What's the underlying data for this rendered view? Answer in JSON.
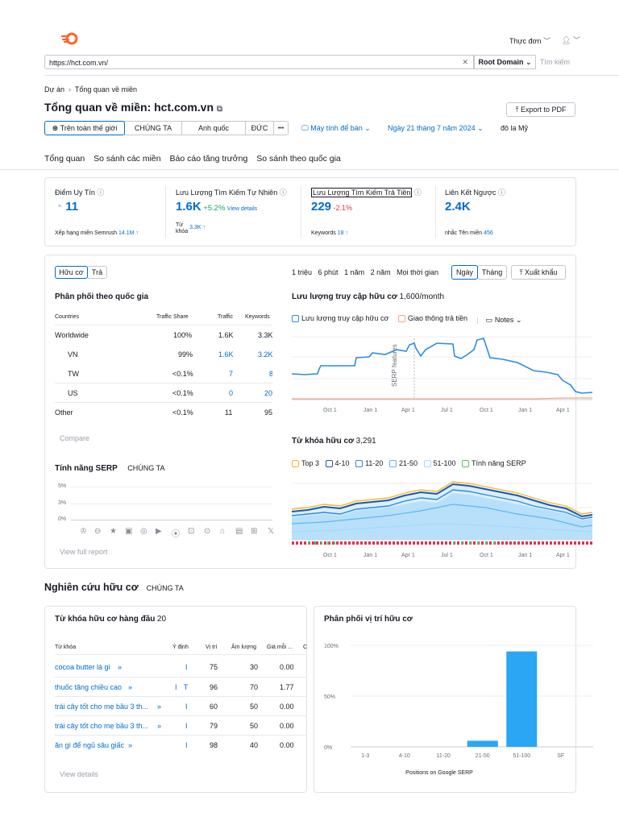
{
  "header": {
    "menu_label": "Thực đơn",
    "user_icon": "user-icon"
  },
  "search": {
    "url": "https://hct.com.vn/",
    "scope": "Root Domain",
    "search_button": "Tìm kiếm"
  },
  "breadcrumb": {
    "root": "Dự án",
    "current": "Tổng quan về miền"
  },
  "page_title": "Tổng quan về miền: hct.com.vn",
  "export_pdf": "Export to PDF",
  "region_tabs": [
    "Trên toàn thế giới",
    "CHÚNG TA",
    "Anh quốc",
    "ĐỨC"
  ],
  "more": "•••",
  "device": "Máy tính để bàn",
  "date": "Ngày 21 tháng 7 năm 2024",
  "currency": "đô la Mỹ",
  "main_tabs": [
    "Tổng quan",
    "So sánh các miền",
    "Báo cáo tăng trưởng",
    "So sánh theo quốc gia"
  ],
  "metrics": {
    "authority": {
      "label": "Điểm Uy Tín",
      "value": "11",
      "sub_label": "Xếp hạng miền Semrush",
      "sub_value": "14.1M ↑"
    },
    "organic": {
      "label": "Lưu Lượng Tìm Kiếm Tự Nhiên",
      "value": "1.6K",
      "change": "+5.2%",
      "link": "View details",
      "kw_label_1": "Từ",
      "kw_label_2": "khóa",
      "kw_value": "3.3K ↑"
    },
    "paid": {
      "label": "Lưu Lượng Tìm Kiếm Trả Tiền",
      "value": "229",
      "change": "-2.1%",
      "kw_label": "Keywords",
      "kw_value": "18 ↑"
    },
    "backlinks": {
      "label": "Liên Kết Ngược",
      "value": "2.4K",
      "sub_label": "nhắc Tên miền",
      "sub_value": "456"
    }
  },
  "toggle": {
    "organic": "Hữu cơ",
    "paid": "Trả"
  },
  "ranges": [
    "1 triệu",
    "6 phút",
    "1 năm",
    "2 năm",
    "Mọi thời gian"
  ],
  "granularity": {
    "day": "Ngày",
    "month": "Tháng"
  },
  "export": "Xuất khẩu",
  "country_dist": {
    "title": "Phân phối theo quốc gia",
    "headers": [
      "Countries",
      "Traffic Share",
      "Traffic",
      "Keywords"
    ],
    "rows": [
      {
        "country": "Worldwide",
        "share": "100%",
        "traffic": "1.6K",
        "kw": "3.3K"
      },
      {
        "country": "VN",
        "share": "99%",
        "traffic": "1.6K",
        "kw": "3.2K"
      },
      {
        "country": "TW",
        "share": "<0.1%",
        "traffic": "7",
        "kw": "8"
      },
      {
        "country": "US",
        "share": "<0.1%",
        "traffic": "0",
        "kw": "20"
      },
      {
        "country": "Other",
        "share": "<0.1%",
        "traffic": "11",
        "kw": "95"
      }
    ],
    "compare": "Compare"
  },
  "serp": {
    "title": "Tính năng SERP",
    "region": "CHÚNG TA",
    "ticks": [
      "5%",
      "3%",
      "0%"
    ],
    "view_full": "View full report"
  },
  "traffic_chart": {
    "title": "Lưu lượng truy cập hữu cơ",
    "value": "1,600/month",
    "legend": [
      "Lưu lượng truy cập hữu cơ",
      "Giao thông trả tiền"
    ],
    "notes": "Notes",
    "annotation": "SERP features",
    "x_labels": [
      "Oct 1",
      "Jan 1",
      "Apr 1",
      "Jul 1",
      "Oct 1",
      "Jan 1",
      "Apr 1"
    ]
  },
  "kw_chart": {
    "title": "Từ khóa hữu cơ",
    "value": "3,291",
    "legend": [
      "Top 3",
      "4-10",
      "11-20",
      "21-50",
      "51-100",
      "Tính năng SERP"
    ],
    "x_labels": [
      "Oct 1",
      "Jan 1",
      "Apr 1",
      "Jul 1",
      "Oct 1",
      "Jan 1",
      "Apr 1"
    ]
  },
  "research": {
    "title": "Nghiên cứu hữu cơ",
    "region": "CHÚNG TA"
  },
  "top_kw": {
    "title": "Từ khóa hữu cơ hàng đầu",
    "count": "20",
    "headers": [
      "Từ khóa",
      "Ý định",
      "Vị trí",
      "Âm lượng",
      "Giá mỗi ...",
      "C"
    ],
    "rows": [
      {
        "kw": "cocoa butter là gì",
        "intent": "I",
        "pos": "75",
        "vol": "30",
        "cpc": "0.00"
      },
      {
        "kw": "thuốc tăng chiều cao",
        "intent": "I T",
        "pos": "96",
        "vol": "70",
        "cpc": "1.77"
      },
      {
        "kw": "trái cây tốt cho mẹ bầu 3 th...",
        "intent": "I",
        "pos": "60",
        "vol": "50",
        "cpc": "0.00"
      },
      {
        "kw": "trái cây tốt cho mẹ bầu 3 th...",
        "intent": "I",
        "pos": "79",
        "vol": "50",
        "cpc": "0.00"
      },
      {
        "kw": "ăn gì để ngủ sâu giấc",
        "intent": "I",
        "pos": "98",
        "vol": "40",
        "cpc": "0.00"
      }
    ],
    "view_details": "View details"
  },
  "chart_data": {
    "type": "bar",
    "title": "Phân phối vị trí hữu cơ",
    "xlabel": "Positions on Google SERP",
    "ylabel": "",
    "categories": [
      "1-3",
      "4-10",
      "11-20",
      "21-50",
      "51-100",
      "SF"
    ],
    "values": [
      0,
      0,
      0,
      6,
      94,
      0
    ],
    "y_ticks": [
      "100%",
      "50%",
      "0%"
    ],
    "ylim": [
      0,
      100
    ],
    "bar_color": "#2aa6f5"
  },
  "colors": {
    "accent": "#006dca",
    "orange": "#ff642d",
    "traffic_line": "#2a8ce6",
    "paid_line": "#f7a98a"
  }
}
